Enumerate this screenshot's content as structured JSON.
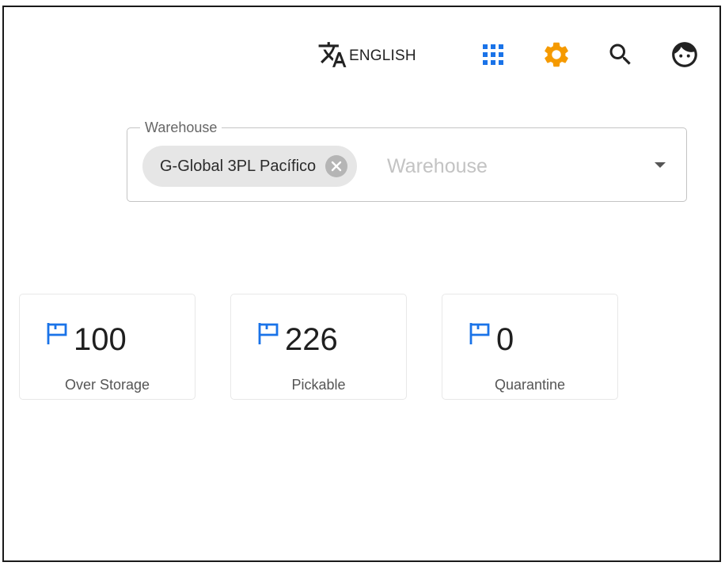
{
  "header": {
    "language_label": "ENGLISH",
    "icons": {
      "translate": "translate-icon",
      "apps": "apps-grid-icon",
      "settings": "gear-icon",
      "search": "search-icon",
      "account": "face-icon"
    }
  },
  "warehouse_filter": {
    "label": "Warehouse",
    "selected_chip": "G-Global 3PL Pacífico",
    "placeholder": "Warehouse"
  },
  "stats": [
    {
      "value": "100",
      "label": "Over Storage"
    },
    {
      "value": "226",
      "label": "Pickable"
    },
    {
      "value": "0",
      "label": "Quarantine"
    }
  ],
  "colors": {
    "accent_blue": "#1a73e8",
    "settings_orange": "#f59a00",
    "text_dark": "#212121"
  }
}
